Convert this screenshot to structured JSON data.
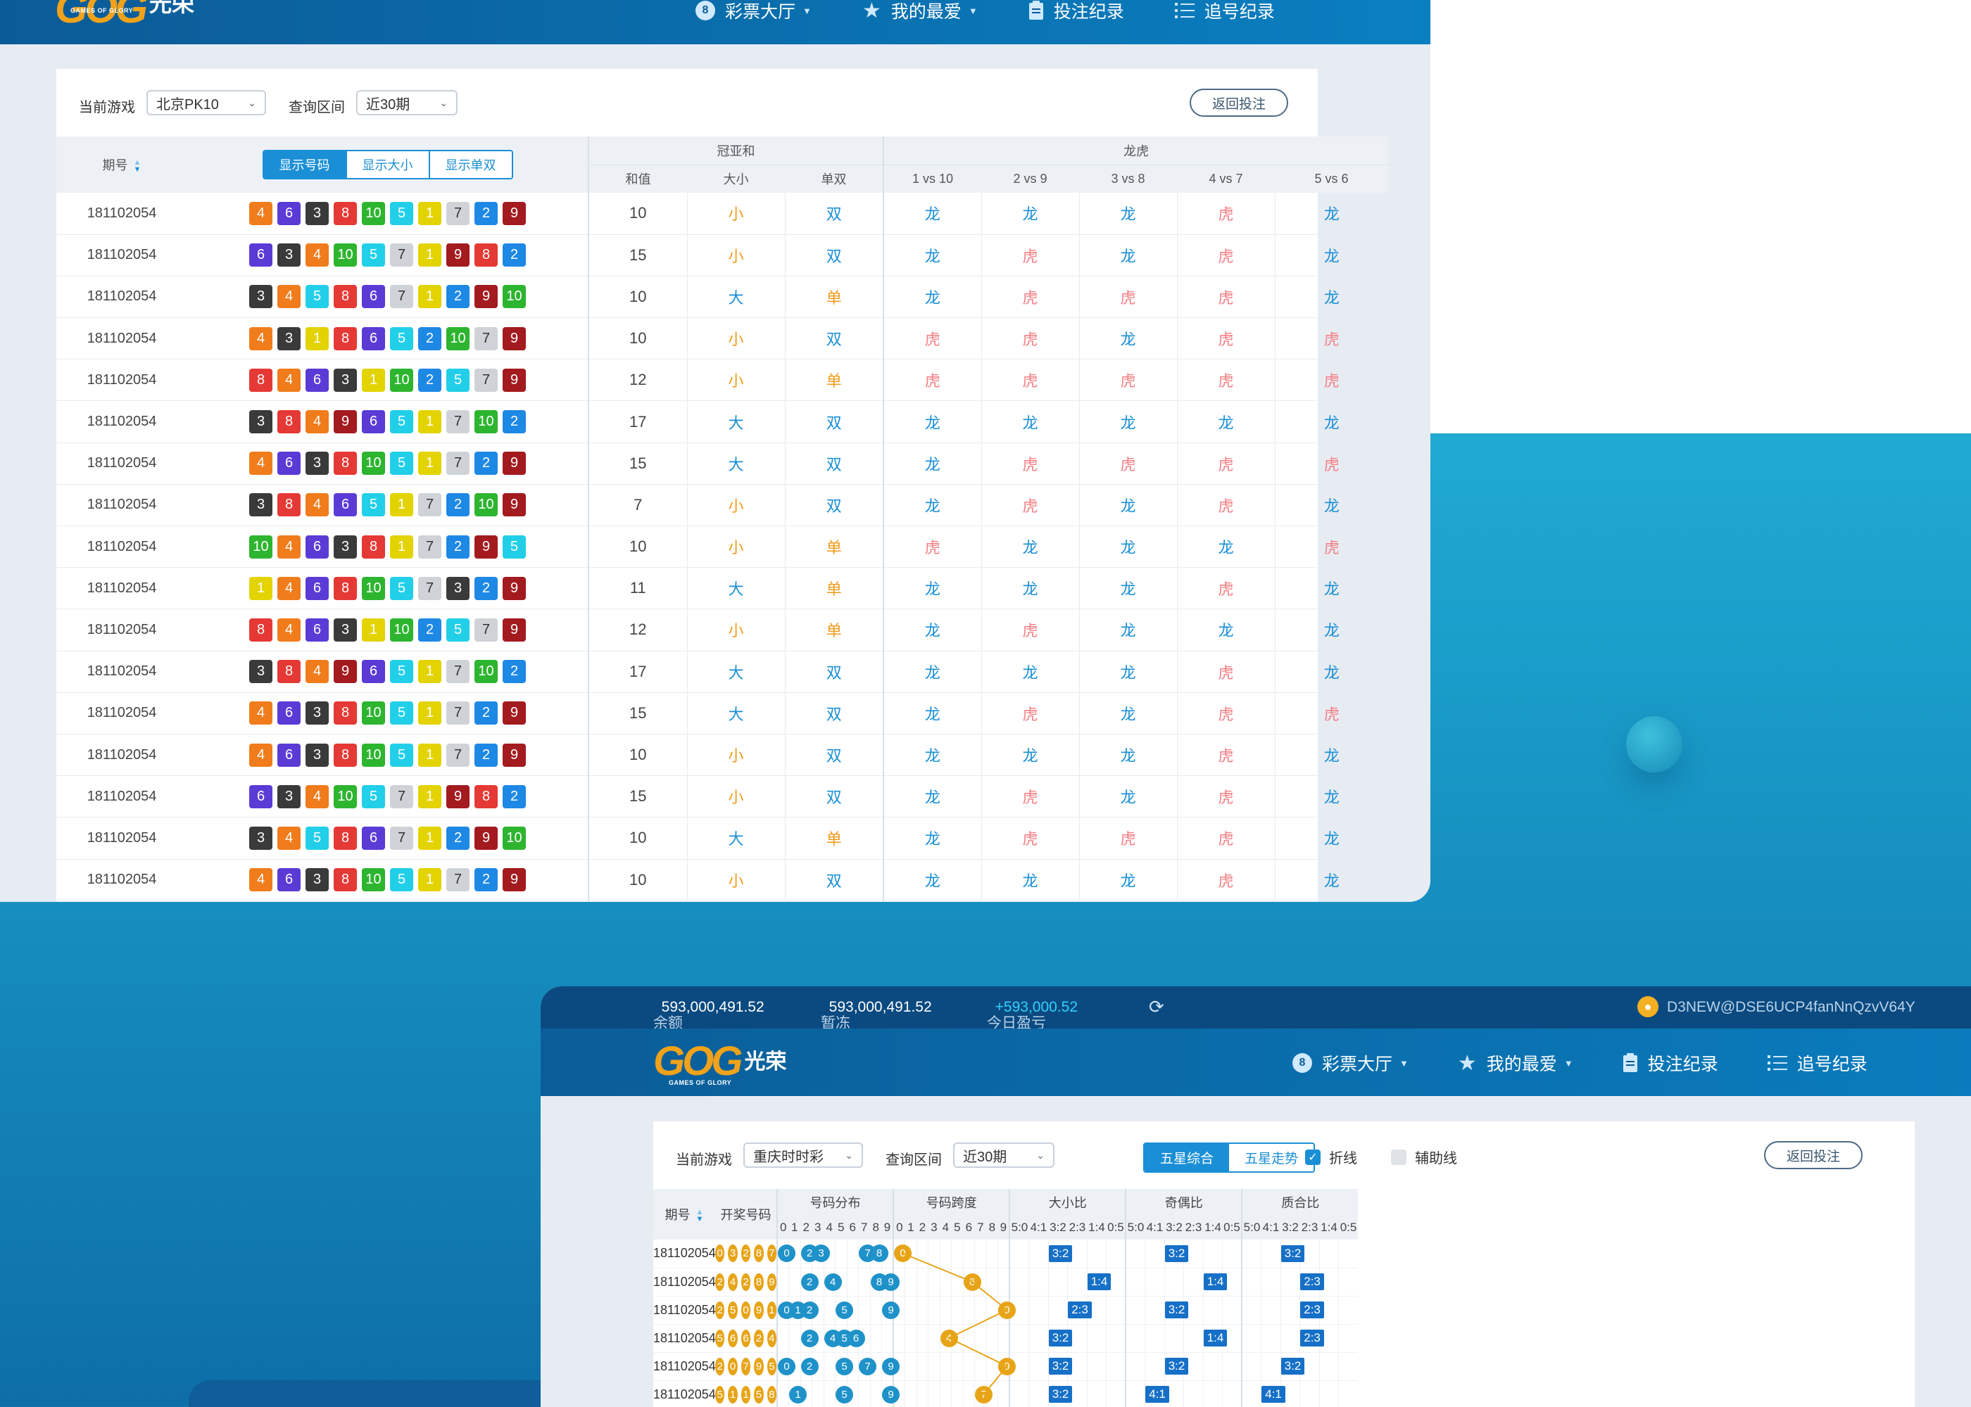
{
  "brand": {
    "logo_letters": "GOG",
    "logo_cn": "光荣",
    "logo_sub": "GAMES OF GLORY"
  },
  "nav": {
    "items": [
      {
        "label": "彩票大厅",
        "icon": "lottery-coin-icon",
        "has_caret": true
      },
      {
        "label": "我的最爱",
        "icon": "star-icon",
        "has_caret": true
      },
      {
        "label": "投注纪录",
        "icon": "clipboard-icon",
        "has_caret": false
      },
      {
        "label": "追号纪录",
        "icon": "list-icon",
        "has_caret": false
      }
    ]
  },
  "panel1": {
    "filter": {
      "game_label": "当前游戏",
      "game_value": "北京PK10",
      "range_label": "查询区间",
      "range_value": "近30期",
      "return_button": "返回投注"
    },
    "headers": {
      "period": "期号",
      "group_sum": "冠亚和",
      "group_dt": "龙虎",
      "sum": "和值",
      "size": "大小",
      "parity": "单双",
      "vs": [
        "1 vs 10",
        "2 vs 9",
        "3 vs 8",
        "4 vs 7",
        "5 vs 6"
      ]
    },
    "toggle": {
      "items": [
        "显示号码",
        "显示大小",
        "显示单双"
      ],
      "active": 0
    },
    "ball_colors": {
      "1": "#e3d300",
      "2": "#1e88e5",
      "3": "#3a3a3a",
      "4": "#f07c1b",
      "5": "#22cfe8",
      "6": "#5a3bd6",
      "7": "#cfd3d8",
      "8": "#e53935",
      "9": "#a31a1f",
      "10": "#2db52f"
    },
    "result_colors": {
      "小": "#f09a1a",
      "大": "#1a8fd6",
      "双": "#1a8fd6",
      "单": "#f09a1a",
      "龙": "#1a8fd6",
      "虎": "#f57e83"
    },
    "rows": [
      {
        "period": "181102054",
        "balls": [
          4,
          6,
          3,
          8,
          10,
          5,
          1,
          7,
          2,
          9
        ],
        "sum": "10",
        "size": "小",
        "parity": "双",
        "dt": [
          "龙",
          "龙",
          "龙",
          "虎",
          "龙"
        ]
      },
      {
        "period": "181102054",
        "balls": [
          6,
          3,
          4,
          10,
          5,
          7,
          1,
          9,
          8,
          2
        ],
        "sum": "15",
        "size": "小",
        "parity": "双",
        "dt": [
          "龙",
          "虎",
          "龙",
          "虎",
          "龙"
        ]
      },
      {
        "period": "181102054",
        "balls": [
          3,
          4,
          5,
          8,
          6,
          7,
          1,
          2,
          9,
          10
        ],
        "sum": "10",
        "size": "大",
        "parity": "单",
        "dt": [
          "龙",
          "虎",
          "虎",
          "虎",
          "龙"
        ]
      },
      {
        "period": "181102054",
        "balls": [
          4,
          3,
          1,
          8,
          6,
          5,
          2,
          10,
          7,
          9
        ],
        "sum": "10",
        "size": "小",
        "parity": "双",
        "dt": [
          "虎",
          "虎",
          "龙",
          "虎",
          "虎"
        ]
      },
      {
        "period": "181102054",
        "balls": [
          8,
          4,
          6,
          3,
          1,
          10,
          2,
          5,
          7,
          9
        ],
        "sum": "12",
        "size": "小",
        "parity": "单",
        "dt": [
          "虎",
          "虎",
          "虎",
          "虎",
          "虎"
        ]
      },
      {
        "period": "181102054",
        "balls": [
          3,
          8,
          4,
          9,
          6,
          5,
          1,
          7,
          10,
          2
        ],
        "sum": "17",
        "size": "大",
        "parity": "双",
        "dt": [
          "龙",
          "龙",
          "龙",
          "龙",
          "龙"
        ]
      },
      {
        "period": "181102054",
        "balls": [
          4,
          6,
          3,
          8,
          10,
          5,
          1,
          7,
          2,
          9
        ],
        "sum": "15",
        "size": "大",
        "parity": "双",
        "dt": [
          "龙",
          "虎",
          "虎",
          "虎",
          "虎"
        ]
      },
      {
        "period": "181102054",
        "balls": [
          3,
          8,
          4,
          6,
          5,
          1,
          7,
          2,
          10,
          9
        ],
        "sum": "7",
        "size": "小",
        "parity": "双",
        "dt": [
          "龙",
          "虎",
          "龙",
          "虎",
          "龙"
        ]
      },
      {
        "period": "181102054",
        "balls": [
          10,
          4,
          6,
          3,
          8,
          1,
          7,
          2,
          9,
          5
        ],
        "sum": "10",
        "size": "小",
        "parity": "单",
        "dt": [
          "虎",
          "龙",
          "龙",
          "龙",
          "虎"
        ]
      },
      {
        "period": "181102054",
        "balls": [
          1,
          4,
          6,
          8,
          10,
          5,
          7,
          3,
          2,
          9
        ],
        "sum": "11",
        "size": "大",
        "parity": "单",
        "dt": [
          "龙",
          "龙",
          "龙",
          "虎",
          "龙"
        ]
      },
      {
        "period": "181102054",
        "balls": [
          8,
          4,
          6,
          3,
          1,
          10,
          2,
          5,
          7,
          9
        ],
        "sum": "12",
        "size": "小",
        "parity": "单",
        "dt": [
          "龙",
          "虎",
          "龙",
          "龙",
          "龙"
        ]
      },
      {
        "period": "181102054",
        "balls": [
          3,
          8,
          4,
          9,
          6,
          5,
          1,
          7,
          10,
          2
        ],
        "sum": "17",
        "size": "大",
        "parity": "双",
        "dt": [
          "龙",
          "龙",
          "龙",
          "虎",
          "龙"
        ]
      },
      {
        "period": "181102054",
        "balls": [
          4,
          6,
          3,
          8,
          10,
          5,
          1,
          7,
          2,
          9
        ],
        "sum": "15",
        "size": "大",
        "parity": "双",
        "dt": [
          "龙",
          "虎",
          "龙",
          "虎",
          "虎"
        ]
      },
      {
        "period": "181102054",
        "balls": [
          4,
          6,
          3,
          8,
          10,
          5,
          1,
          7,
          2,
          9
        ],
        "sum": "10",
        "size": "小",
        "parity": "双",
        "dt": [
          "龙",
          "龙",
          "龙",
          "虎",
          "龙"
        ]
      },
      {
        "period": "181102054",
        "balls": [
          6,
          3,
          4,
          10,
          5,
          7,
          1,
          9,
          8,
          2
        ],
        "sum": "15",
        "size": "小",
        "parity": "双",
        "dt": [
          "龙",
          "虎",
          "龙",
          "虎",
          "龙"
        ]
      },
      {
        "period": "181102054",
        "balls": [
          3,
          4,
          5,
          8,
          6,
          7,
          1,
          2,
          9,
          10
        ],
        "sum": "10",
        "size": "大",
        "parity": "单",
        "dt": [
          "龙",
          "虎",
          "虎",
          "虎",
          "龙"
        ]
      },
      {
        "period": "181102054",
        "balls": [
          4,
          6,
          3,
          8,
          10,
          5,
          1,
          7,
          2,
          9
        ],
        "sum": "10",
        "size": "小",
        "parity": "双",
        "dt": [
          "龙",
          "龙",
          "龙",
          "虎",
          "龙"
        ]
      }
    ]
  },
  "panel2": {
    "account": {
      "balance_label": "余额",
      "balance": "593,000,491.52",
      "frozen_label": "暂冻",
      "frozen": "593,000,491.52",
      "today_label": "今日盈亏",
      "today": "+593,000.52",
      "user": "D3NEW@DSE6UCP4fanNnQzvV64Y"
    },
    "filter": {
      "game_label": "当前游戏",
      "game_value": "重庆时时彩",
      "range_label": "查询区间",
      "range_value": "近30期",
      "return_button": "返回投注"
    },
    "view_toggle": {
      "items": [
        "五星综合",
        "五星走势"
      ],
      "active": 0
    },
    "checks": [
      {
        "label": "折线",
        "checked": true
      },
      {
        "label": "辅助线",
        "checked": false
      }
    ],
    "headers": {
      "period": "期号",
      "draw": "开奖号码",
      "distribution": "号码分布",
      "span": "号码跨度",
      "size_ratio": "大小比",
      "odd_ratio": "奇偶比",
      "prime_ratio": "质合比",
      "digits": [
        "0",
        "1",
        "2",
        "3",
        "4",
        "5",
        "6",
        "7",
        "8",
        "9"
      ],
      "ratios": [
        "5:0",
        "4:1",
        "3:2",
        "2:3",
        "1:4",
        "0:5"
      ]
    },
    "rows": [
      {
        "period": "181102054",
        "draw": [
          0,
          3,
          2,
          8,
          7
        ],
        "dist": [
          0,
          2,
          3,
          7,
          8
        ],
        "span": 0,
        "size": "3:2",
        "odd": "3:2",
        "prime": "3:2"
      },
      {
        "period": "181102054",
        "draw": [
          2,
          4,
          2,
          8,
          9
        ],
        "dist": [
          2,
          4,
          8,
          9
        ],
        "span": 6,
        "size": "1:4",
        "odd": "1:4",
        "prime": "2:3"
      },
      {
        "period": "181102054",
        "draw": [
          2,
          5,
          0,
          9,
          1
        ],
        "dist": [
          0,
          1,
          2,
          5,
          9
        ],
        "span": 9,
        "size": "2:3",
        "odd": "3:2",
        "prime": "2:3"
      },
      {
        "period": "181102054",
        "draw": [
          5,
          6,
          6,
          2,
          4
        ],
        "dist": [
          2,
          4,
          5,
          6
        ],
        "span": 4,
        "size": "3:2",
        "odd": "1:4",
        "prime": "2:3"
      },
      {
        "period": "181102054",
        "draw": [
          2,
          0,
          7,
          9,
          5
        ],
        "dist": [
          0,
          2,
          5,
          7,
          9
        ],
        "span": 9,
        "size": "3:2",
        "odd": "3:2",
        "prime": "3:2"
      },
      {
        "period": "181102054",
        "draw": [
          5,
          1,
          1,
          5,
          8
        ],
        "dist": [
          1,
          5,
          9
        ],
        "span": 7,
        "size": "3:2",
        "odd": "4:1",
        "prime": "4:1"
      }
    ]
  }
}
